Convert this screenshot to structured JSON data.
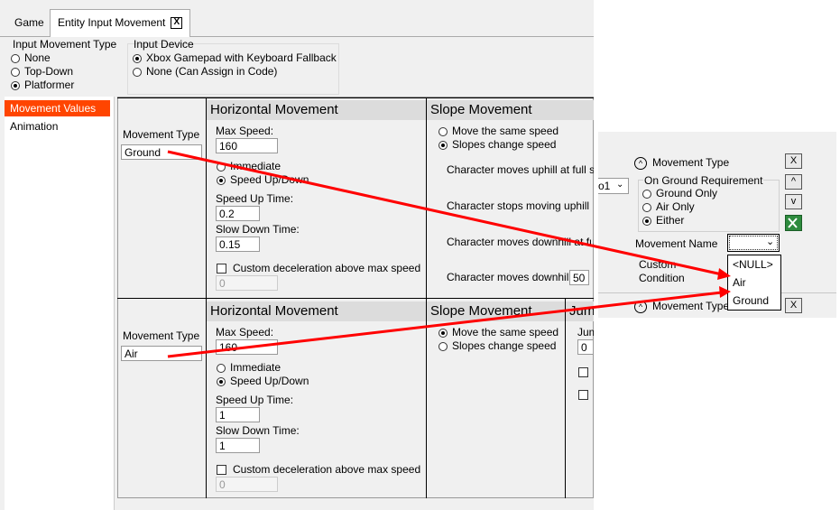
{
  "tabs": [
    {
      "label": "Game"
    },
    {
      "label": "Entity Input Movement"
    }
  ],
  "tab_close_glyph": "X",
  "input_movement_type": {
    "title": "Input Movement Type",
    "options": [
      "None",
      "Top-Down",
      "Platformer"
    ],
    "selected": "Platformer"
  },
  "input_device": {
    "title": "Input Device",
    "options": [
      "Xbox Gamepad with Keyboard Fallback",
      "None (Can Assign in Code)"
    ],
    "selected": "Xbox Gamepad with Keyboard Fallback"
  },
  "sidebar": {
    "items": [
      "Movement Values",
      "Animation"
    ],
    "selected": "Movement Values"
  },
  "rows": [
    {
      "movement_type_label": "Movement Type",
      "movement_type_value": "Ground",
      "horizontal": {
        "title": "Horizontal Movement",
        "max_speed_label": "Max Speed:",
        "max_speed": "160",
        "immediate": "Immediate",
        "speed_updown": "Speed Up/Down",
        "selected": "Speed Up/Down",
        "speed_up_label": "Speed Up Time:",
        "speed_up": "0.2",
        "slow_down_label": "Slow Down Time:",
        "slow_down": "0.15",
        "custom_decel": "Custom deceleration above max speed",
        "custom_decel_value": "0"
      },
      "slope": {
        "title": "Slope Movement",
        "opt1": "Move the same speed",
        "opt2": "Slopes change speed",
        "selected": "Slopes change speed",
        "lines": [
          "Character moves uphill at full s",
          "Character stops moving uphill",
          "Character moves downhill at fu",
          "Character moves downhill"
        ],
        "downhill_value": "50"
      }
    },
    {
      "movement_type_label": "Movement Type",
      "movement_type_value": "Air",
      "horizontal": {
        "title": "Horizontal Movement",
        "max_speed_label": "Max Speed:",
        "max_speed": "160",
        "immediate": "Immediate",
        "speed_updown": "Speed Up/Down",
        "selected": "Speed Up/Down",
        "speed_up_label": "Speed Up Time:",
        "speed_up": "1",
        "slow_down_label": "Slow Down Time:",
        "slow_down": "1",
        "custom_decel": "Custom deceleration above max speed",
        "custom_decel_value": "0"
      },
      "slope": {
        "title": "Slope Movement",
        "opt1": "Move the same speed",
        "opt2": "Slopes change speed",
        "selected": "Move the same speed"
      },
      "jump": {
        "title": "Jum",
        "field_label": "Jum",
        "field_value": "0"
      }
    }
  ],
  "right_panel": {
    "header1": "Movement Type",
    "close_glyph": "X",
    "up_glyph": "^",
    "down_glyph": "v",
    "partial_combo": "o1",
    "ground_req_title": "On Ground Requirement",
    "ground_req_options": [
      "Ground Only",
      "Air Only",
      "Either"
    ],
    "ground_req_selected": "Either",
    "movement_name_label": "Movement Name",
    "custom_condition_label": "Custom",
    "custom_condition_label2": "Condition",
    "dropdown_options": [
      "<NULL>",
      "Air",
      "Ground"
    ],
    "header2": "Movement Type"
  },
  "colors": {
    "accent": "#ff4500",
    "arrow": "#ff0000",
    "panel_bg": "#f0f0f0",
    "header_band": "#dcdcdc"
  }
}
